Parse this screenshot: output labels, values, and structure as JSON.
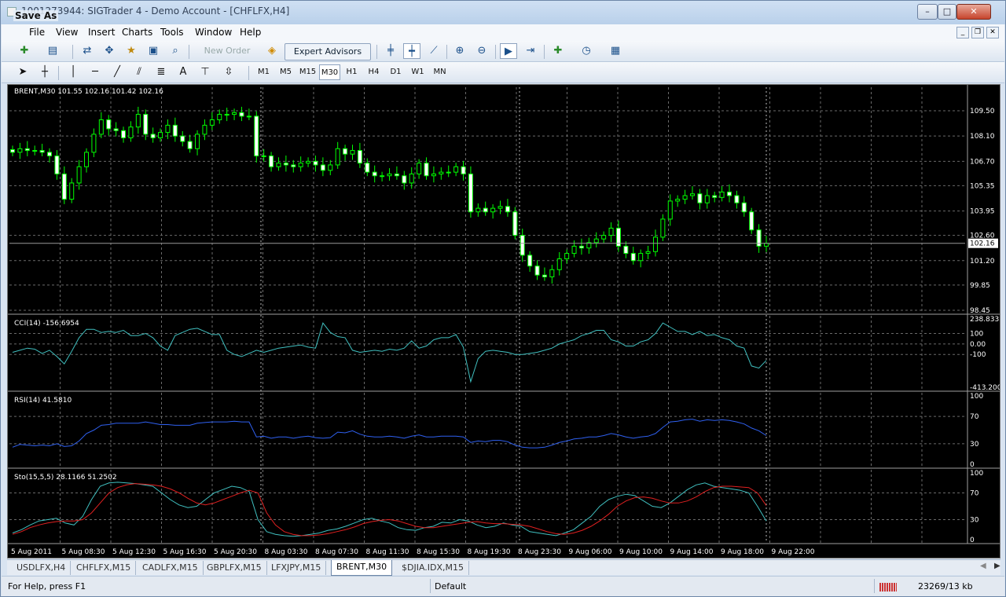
{
  "window": {
    "title": "1001273944: SIGTrader 4 - Demo Account - [CHFLFX,H4]",
    "overlay_title": "Save As",
    "controls": {
      "minimize": "–",
      "maximize": "□",
      "close": "✕"
    }
  },
  "menu": [
    "File",
    "View",
    "Insert",
    "Charts",
    "Tools",
    "Window",
    "Help"
  ],
  "mdi_controls": {
    "minimize": "_",
    "restore": "❐",
    "close": "✕"
  },
  "toolbar": {
    "new_order": "New Order",
    "expert_advisors": "Expert Advisors",
    "timeframes": [
      "M1",
      "M5",
      "M15",
      "M30",
      "H1",
      "H4",
      "D1",
      "W1",
      "MN"
    ],
    "active_timeframe": "M30",
    "text_tool": "A"
  },
  "chart": {
    "header": "BRENT,M30  101.55 102.16 101.42 102.16",
    "price_ticks": [
      "109.50",
      "108.10",
      "106.70",
      "105.35",
      "103.95",
      "102.60",
      "101.20",
      "99.85",
      "98.45"
    ],
    "current_price": "102.16",
    "time_labels": [
      "5 Aug 2011",
      "5 Aug 08:30",
      "5 Aug 12:30",
      "5 Aug 16:30",
      "5 Aug 20:30",
      "8 Aug 03:30",
      "8 Aug 07:30",
      "8 Aug 11:30",
      "8 Aug 15:30",
      "8 Aug 19:30",
      "8 Aug 23:30",
      "9 Aug 06:00",
      "9 Aug 10:00",
      "9 Aug 14:00",
      "9 Aug 18:00",
      "9 Aug 22:00"
    ]
  },
  "chart_data": [
    {
      "type": "candlestick",
      "series": [
        {
          "name": "BRENT,M30",
          "close": [
            107.2,
            107.4,
            107.3,
            107.3,
            107.2,
            107.0,
            106.0,
            104.6,
            105.5,
            106.4,
            107.2,
            108.2,
            109.0,
            108.5,
            108.4,
            108.0,
            108.6,
            109.3,
            108.2,
            108.0,
            108.3,
            108.7,
            108.1,
            107.8,
            107.4,
            108.2,
            108.7,
            109.0,
            109.3,
            109.3,
            109.4,
            109.2,
            109.2,
            107.0,
            107.0,
            106.4,
            106.6,
            106.5,
            106.4,
            106.6,
            106.7,
            106.5,
            106.2,
            106.5,
            107.4,
            107.1,
            107.3,
            106.6,
            106.1,
            105.9,
            105.9,
            106.0,
            105.9,
            105.5,
            106.0,
            106.6,
            105.9,
            106.0,
            106.1,
            106.1,
            106.4,
            106.0,
            103.9,
            104.1,
            103.9,
            104.1,
            104.2,
            103.9,
            102.6,
            101.5,
            100.9,
            100.4,
            100.3,
            100.7,
            101.3,
            101.6,
            102.0,
            101.9,
            102.2,
            102.4,
            102.6,
            103.0,
            102.0,
            101.6,
            101.2,
            101.6,
            101.7,
            102.5,
            103.5,
            104.5,
            104.6,
            104.8,
            104.9,
            104.4,
            104.8,
            104.7,
            105.0,
            104.8,
            104.4,
            103.9,
            102.9,
            102.0,
            102.16
          ]
        }
      ],
      "price_axis": {
        "min": 98.45,
        "max": 109.5,
        "ticks": [
          109.5,
          108.1,
          106.7,
          105.35,
          103.95,
          102.6,
          101.2,
          99.85,
          98.45
        ]
      },
      "time_labels": [
        "5 Aug 2011",
        "5 Aug 08:30",
        "5 Aug 12:30",
        "5 Aug 16:30",
        "5 Aug 20:30",
        "8 Aug 03:30",
        "8 Aug 07:30",
        "8 Aug 11:30",
        "8 Aug 15:30",
        "8 Aug 19:30",
        "8 Aug 23:30",
        "9 Aug 06:00",
        "9 Aug 10:00",
        "9 Aug 14:00",
        "9 Aug 18:00",
        "9 Aug 22:00"
      ],
      "grid": true,
      "colors": {
        "background": "#000000",
        "bull": "#ffffff",
        "bear": "#000000",
        "wick": "#00ff00"
      }
    },
    {
      "type": "line",
      "title": "CCI(14) -156.6954",
      "series": [
        {
          "name": "CCI(14)",
          "values": [
            -80,
            -60,
            -40,
            -50,
            -90,
            -60,
            -120,
            -190,
            -70,
            60,
            140,
            140,
            110,
            120,
            110,
            130,
            80,
            80,
            100,
            60,
            -20,
            -60,
            80,
            110,
            140,
            150,
            120,
            90,
            90,
            -60,
            -100,
            -120,
            -90,
            -60,
            -80,
            -60,
            -40,
            -30,
            -20,
            -10,
            -30,
            -40,
            200,
            110,
            70,
            60,
            -60,
            -80,
            -70,
            -60,
            -70,
            -50,
            -60,
            -40,
            30,
            -40,
            -20,
            40,
            60,
            60,
            90,
            -30,
            -360,
            -140,
            -70,
            -60,
            -70,
            -80,
            -100,
            -100,
            -90,
            -80,
            -60,
            -40,
            0,
            20,
            40,
            80,
            100,
            130,
            130,
            40,
            20,
            -20,
            -20,
            20,
            40,
            100,
            200,
            160,
            120,
            120,
            90,
            120,
            80,
            90,
            60,
            40,
            -20,
            -40,
            -210,
            -230,
            -157
          ]
        }
      ],
      "ylim": [
        -413.2,
        238.8333
      ],
      "y_ticks": [
        "238.8333",
        "100",
        "0.00",
        "-100",
        "-413.200"
      ],
      "grid": true,
      "colors": {
        "line": "#40c0c0"
      }
    },
    {
      "type": "line",
      "title": "RSI(14) 41.5810",
      "series": [
        {
          "name": "RSI(14)",
          "values": [
            25,
            29,
            28,
            27,
            28,
            27,
            30,
            26,
            27,
            34,
            45,
            50,
            57,
            58,
            60,
            60,
            60,
            60,
            62,
            60,
            58,
            58,
            57,
            57,
            57,
            60,
            61,
            62,
            62,
            62,
            63,
            62,
            62,
            40,
            41,
            38,
            40,
            40,
            38,
            40,
            41,
            39,
            38,
            39,
            47,
            46,
            49,
            44,
            41,
            40,
            40,
            41,
            40,
            38,
            41,
            43,
            40,
            40,
            41,
            41,
            41,
            40,
            32,
            34,
            33,
            35,
            35,
            33,
            28,
            25,
            24,
            24,
            25,
            28,
            32,
            34,
            37,
            38,
            40,
            40,
            42,
            45,
            43,
            40,
            38,
            40,
            41,
            45,
            54,
            62,
            63,
            65,
            66,
            63,
            65,
            64,
            65,
            64,
            62,
            59,
            53,
            49,
            42
          ]
        }
      ],
      "ylim": [
        0,
        100
      ],
      "y_ticks": [
        "100",
        "70",
        "30",
        "0"
      ],
      "grid": true,
      "colors": {
        "line": "#2f60f0"
      }
    },
    {
      "type": "line",
      "title": "Sto(15,5,5) 28.1166 51.2502",
      "series": [
        {
          "name": "Sto(15,5,5) main",
          "values": [
            10,
            15,
            22,
            28,
            30,
            32,
            25,
            22,
            35,
            60,
            80,
            85,
            86,
            85,
            84,
            82,
            80,
            70,
            60,
            52,
            48,
            50,
            60,
            70,
            75,
            80,
            78,
            72,
            30,
            12,
            8,
            6,
            5,
            6,
            8,
            10,
            14,
            16,
            20,
            25,
            30,
            32,
            28,
            25,
            18,
            15,
            14,
            18,
            20,
            26,
            25,
            30,
            28,
            22,
            18,
            20,
            25,
            22,
            20,
            12,
            10,
            8,
            6,
            10,
            15,
            25,
            35,
            50,
            60,
            65,
            68,
            66,
            58,
            50,
            48,
            55,
            65,
            75,
            82,
            85,
            80,
            78,
            76,
            74,
            70,
            50,
            28
          ]
        },
        {
          "name": "Sto(15,5,5) signal",
          "values": [
            8,
            12,
            18,
            22,
            25,
            27,
            28,
            28,
            30,
            40,
            55,
            70,
            78,
            82,
            84,
            83,
            82,
            80,
            76,
            70,
            62,
            55,
            52,
            55,
            60,
            65,
            70,
            74,
            70,
            40,
            22,
            12,
            8,
            6,
            6,
            7,
            9,
            12,
            15,
            19,
            24,
            27,
            29,
            30,
            28,
            24,
            20,
            18,
            18,
            20,
            22,
            24,
            26,
            27,
            25,
            24,
            24,
            23,
            22,
            20,
            16,
            12,
            9,
            8,
            10,
            14,
            20,
            28,
            38,
            50,
            58,
            63,
            64,
            62,
            58,
            55,
            55,
            58,
            64,
            72,
            78,
            80,
            80,
            79,
            78,
            70,
            51
          ]
        }
      ],
      "ylim": [
        0,
        100
      ],
      "y_ticks": [
        "100",
        "70",
        "30",
        "0"
      ],
      "grid": true,
      "colors": {
        "main": "#40c0c0",
        "signal": "#e02020"
      }
    }
  ],
  "tabs": [
    "USDLFX,H4",
    "CHFLFX,M15",
    "CADLFX,M15",
    "GBPLFX,M15",
    "LFXJPY,M15",
    "BRENT,M30",
    "$DJIA.IDX,M15"
  ],
  "active_tab": "BRENT,M30",
  "status": {
    "help": "For Help, press F1",
    "profile": "Default",
    "traffic": "23269/13 kb"
  }
}
